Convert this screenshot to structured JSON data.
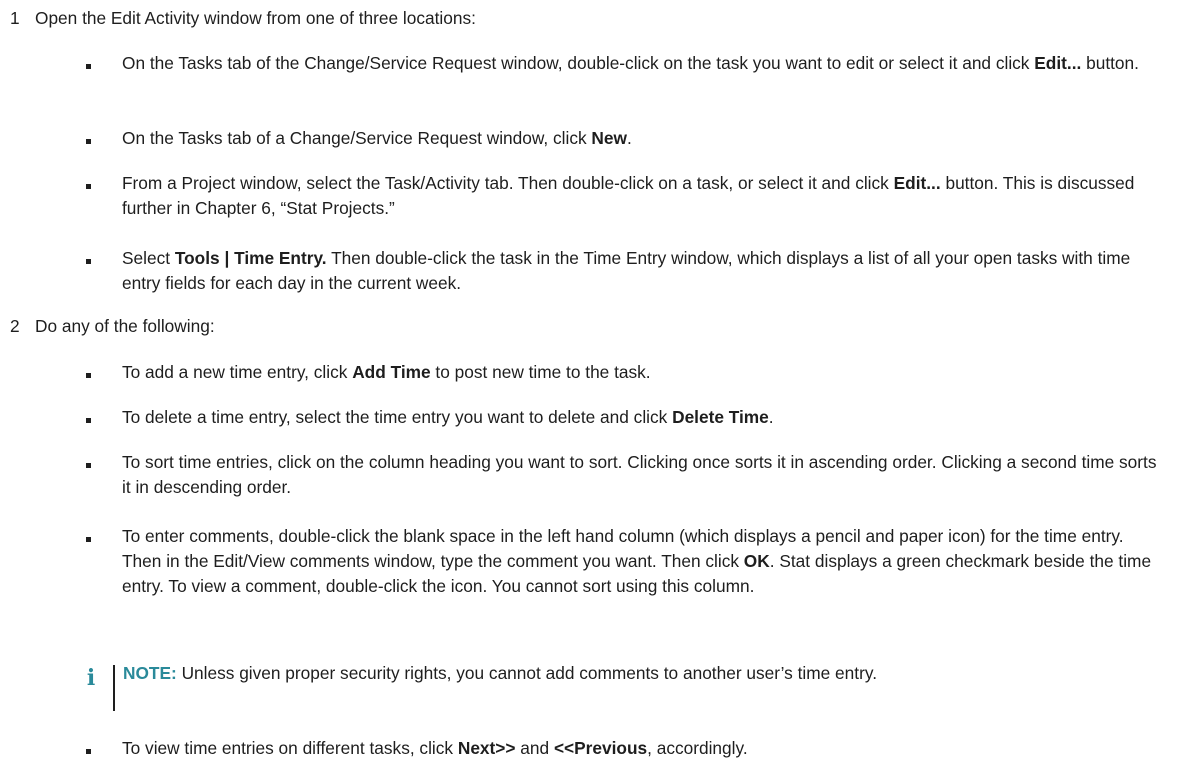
{
  "step1": {
    "number": "1",
    "text": "Open the Edit Activity window from one of three locations:",
    "bullets": [
      {
        "parts": [
          {
            "t": "On the Tasks tab of the Change/Service Request window, double-click on the task you want to edit or select it and click "
          },
          {
            "t": "Edit...",
            "b": true
          },
          {
            "t": " button."
          }
        ]
      },
      {
        "parts": [
          {
            "t": "On the Tasks tab of a Change/Service Request window, click "
          },
          {
            "t": "New",
            "b": true
          },
          {
            "t": "."
          }
        ]
      },
      {
        "parts": [
          {
            "t": "From a Project window, select the Task/Activity tab. Then double-click on a task, or select it and click "
          },
          {
            "t": "Edit...",
            "b": true
          },
          {
            "t": " button. This is discussed further in Chapter 6, “Stat Projects.”"
          }
        ]
      },
      {
        "parts": [
          {
            "t": "Select "
          },
          {
            "t": "Tools | Time Entry.",
            "b": true
          },
          {
            "t": " Then double-click the task in the Time Entry window, which displays a list of all your open tasks with time entry fields for each day in the current week."
          }
        ]
      }
    ]
  },
  "step2": {
    "number": "2",
    "text": "Do any of the following:",
    "bullets": [
      {
        "parts": [
          {
            "t": "To add a new time entry, click "
          },
          {
            "t": "Add Time",
            "b": true
          },
          {
            "t": " to post new time to the task."
          }
        ]
      },
      {
        "parts": [
          {
            "t": "To delete a time entry, select the time entry you want to delete and click "
          },
          {
            "t": "Delete Time",
            "b": true
          },
          {
            "t": "."
          }
        ]
      },
      {
        "parts": [
          {
            "t": "To sort time entries, click on the column heading you want to sort. Clicking once sorts it in ascending order. Clicking a second time sorts it in descending order."
          }
        ]
      },
      {
        "parts": [
          {
            "t": "To enter comments, double-click the blank space in the left hand column (which displays a pencil and paper icon) for the time entry. Then in the Edit/View comments window, type the comment you want. Then click "
          },
          {
            "t": "OK",
            "b": true
          },
          {
            "t": ". Stat displays a green checkmark beside the time entry. To view a comment, double-click the icon. You cannot sort using this column."
          }
        ]
      },
      {
        "parts": [
          {
            "t": "To view time entries on different tasks, click "
          },
          {
            "t": "Next>>",
            "b": true
          },
          {
            "t": " and "
          },
          {
            "t": "<<Previous",
            "b": true
          },
          {
            "t": ", accordingly."
          }
        ]
      }
    ]
  },
  "note": {
    "icon": "info-icon",
    "icon_glyph": "i",
    "label": "NOTE:",
    "text": " Unless given proper security rights, you cannot add comments to another user’s time entry.",
    "accent_color": "#2a8a9a"
  }
}
